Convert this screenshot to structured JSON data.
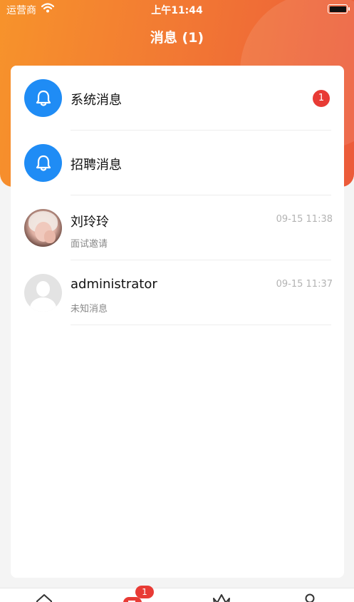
{
  "status_bar": {
    "carrier": "运营商",
    "time": "上午11:44"
  },
  "header": {
    "title": "消息 (1)"
  },
  "messages": [
    {
      "title": "系统消息",
      "icon": "bell-icon",
      "badge": "1"
    },
    {
      "title": "招聘消息",
      "icon": "bell-icon"
    },
    {
      "title": "刘玲玲",
      "subtitle": "面试邀请",
      "time": "09-15 11:38"
    },
    {
      "title": "administrator",
      "subtitle": "未知消息",
      "time": "09-15 11:37"
    }
  ],
  "tabbar": {
    "items": [
      {
        "icon": "home-icon"
      },
      {
        "icon": "message-icon",
        "badge": "1"
      },
      {
        "icon": "crown-icon"
      },
      {
        "icon": "user-icon"
      }
    ]
  },
  "colors": {
    "accent_orange": "#f27a33",
    "bell_blue": "#1f8cf5",
    "badge_red": "#e83b35"
  }
}
